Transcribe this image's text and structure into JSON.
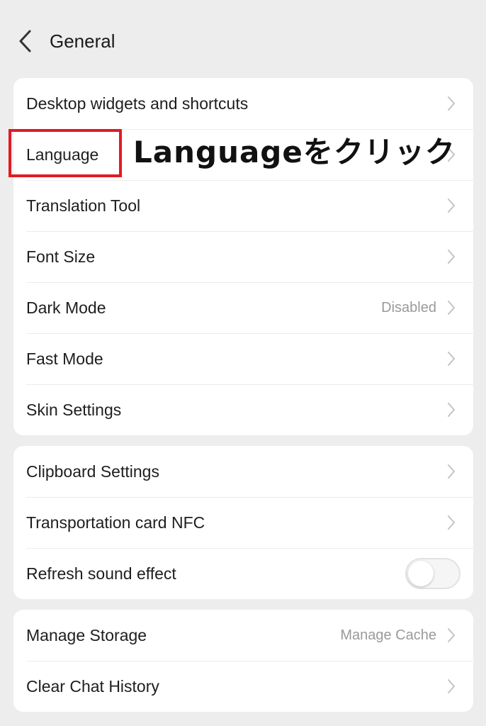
{
  "header": {
    "title": "General",
    "back_icon": "chevron-left-icon"
  },
  "group1": {
    "items": [
      {
        "label": "Desktop widgets and shortcuts",
        "value": ""
      },
      {
        "label": "Language",
        "value": ""
      },
      {
        "label": "Translation Tool",
        "value": ""
      },
      {
        "label": "Font Size",
        "value": ""
      },
      {
        "label": "Dark Mode",
        "value": "Disabled"
      },
      {
        "label": "Fast Mode",
        "value": ""
      },
      {
        "label": "Skin Settings",
        "value": ""
      }
    ]
  },
  "group2": {
    "items": [
      {
        "label": "Clipboard Settings"
      },
      {
        "label": "Transportation card NFC"
      },
      {
        "label": "Refresh sound effect",
        "toggle": false
      }
    ]
  },
  "group3": {
    "items": [
      {
        "label": "Manage Storage",
        "value": "Manage Cache"
      },
      {
        "label": "Clear Chat History",
        "value": ""
      }
    ]
  },
  "annotation": {
    "text": "Languageをクリック",
    "highlight_color": "#e01b24"
  },
  "colors": {
    "background": "#ededed",
    "card": "#ffffff",
    "secondary_text": "#9a9a9a"
  }
}
